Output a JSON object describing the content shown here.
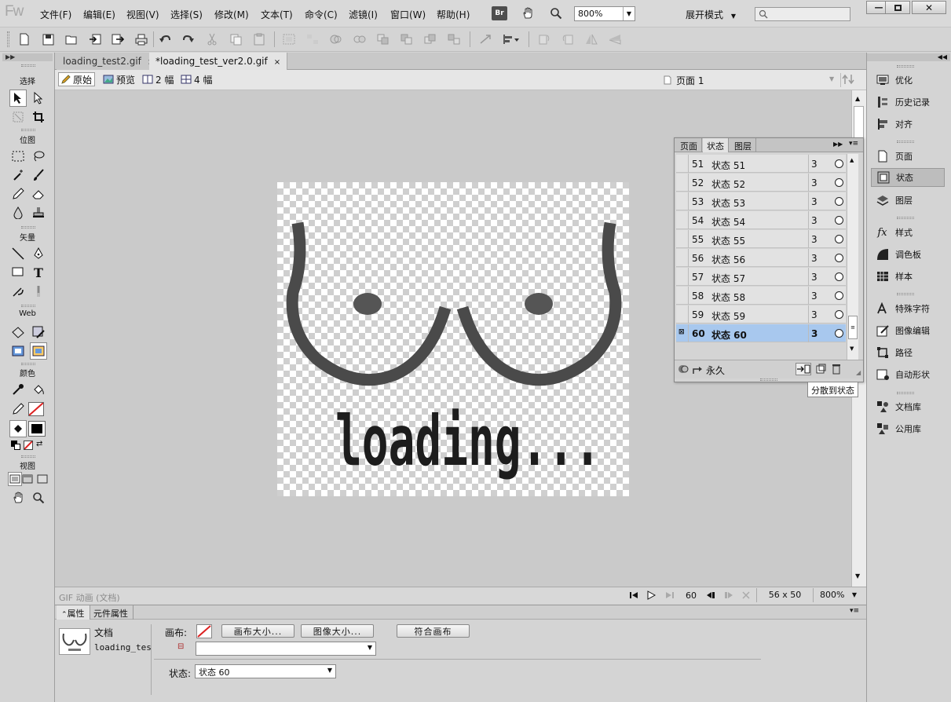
{
  "app": {
    "logo": "Fw"
  },
  "menu": [
    "文件(F)",
    "编辑(E)",
    "视图(V)",
    "选择(S)",
    "修改(M)",
    "文本(T)",
    "命令(C)",
    "滤镜(I)",
    "窗口(W)",
    "帮助(H)"
  ],
  "topbar": {
    "bridge_label": "Br",
    "zoom": "800%",
    "workspace": "展开模式",
    "search_placeholder": ""
  },
  "tools": {
    "sections": [
      "选择",
      "位图",
      "矢量",
      "Web",
      "颜色",
      "视图"
    ]
  },
  "doc_tabs": [
    {
      "label": "loading_test2.gif",
      "close": "×"
    },
    {
      "label": "*loading_test_ver2.0.gif",
      "close": "×"
    }
  ],
  "view_modes": [
    "原始",
    "预览",
    "2 幅",
    "4 幅"
  ],
  "page_selector": "页面 1",
  "canvas": {
    "image_text": "loading..."
  },
  "status": {
    "left": "GIF 动画 (文档)",
    "frame": "60",
    "size": "56 x 50",
    "zoom": "800%"
  },
  "states_panel": {
    "tabs": [
      "页面",
      "状态",
      "图层"
    ],
    "rows": [
      {
        "num": "51",
        "label": "状态 51",
        "delay": "3"
      },
      {
        "num": "52",
        "label": "状态 52",
        "delay": "3"
      },
      {
        "num": "53",
        "label": "状态 53",
        "delay": "3"
      },
      {
        "num": "54",
        "label": "状态 54",
        "delay": "3"
      },
      {
        "num": "55",
        "label": "状态 55",
        "delay": "3"
      },
      {
        "num": "56",
        "label": "状态 56",
        "delay": "3"
      },
      {
        "num": "57",
        "label": "状态 57",
        "delay": "3"
      },
      {
        "num": "58",
        "label": "状态 58",
        "delay": "3"
      },
      {
        "num": "59",
        "label": "状态 59",
        "delay": "3"
      },
      {
        "num": "60",
        "label": "状态 60",
        "delay": "3"
      }
    ],
    "loop_label": "永久",
    "tooltip": "分散到状态"
  },
  "right_panels": [
    "优化",
    "历史记录",
    "对齐",
    "页面",
    "状态",
    "图层",
    "样式",
    "调色板",
    "样本",
    "特殊字符",
    "图像编辑",
    "路径",
    "自动形状",
    "文档库",
    "公用库"
  ],
  "properties": {
    "tabs": [
      "属性",
      "元件属性"
    ],
    "doc_label": "文档",
    "doc_name": "loading_tes",
    "canvas_label": "画布:",
    "canvas_size_btn": "画布大小...",
    "image_size_btn": "图像大小...",
    "fit_canvas_btn": "符合画布",
    "state_label": "状态:",
    "state_value": "状态 60"
  }
}
